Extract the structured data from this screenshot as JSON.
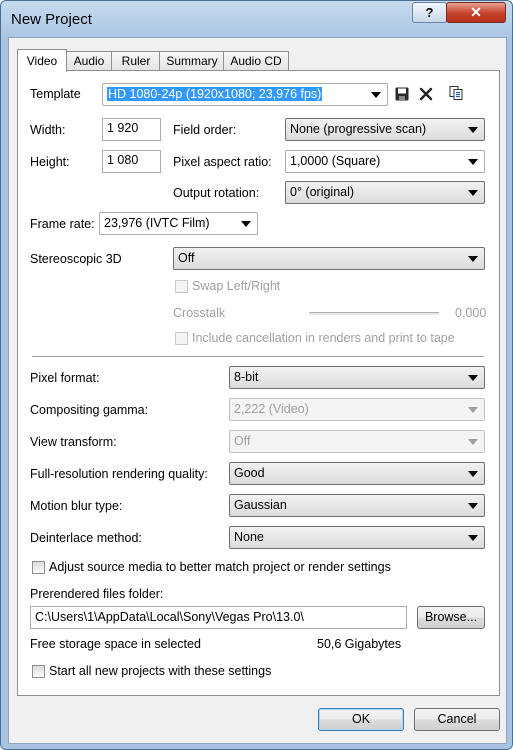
{
  "window": {
    "title": "New Project"
  },
  "titlebar": {
    "help_label": "?",
    "close_label": "✕"
  },
  "tabs": [
    "Video",
    "Audio",
    "Ruler",
    "Summary",
    "Audio CD"
  ],
  "video": {
    "template_label": "Template",
    "template_value": "HD 1080-24p (1920x1080; 23,976 fps)",
    "width_label": "Width:",
    "width_value": "1 920",
    "height_label": "Height:",
    "height_value": "1 080",
    "field_order_label": "Field order:",
    "field_order_value": "None (progressive scan)",
    "pixel_aspect_label": "Pixel aspect ratio:",
    "pixel_aspect_value": "1,0000 (Square)",
    "output_rotation_label": "Output rotation:",
    "output_rotation_value": "0° (original)",
    "frame_rate_label": "Frame rate:",
    "frame_rate_value": "23,976 (IVTC Film)",
    "stereo_label": "Stereoscopic 3D",
    "stereo_value": "Off",
    "swap_label": "Swap Left/Right",
    "crosstalk_label": "Crosstalk",
    "crosstalk_value": "0,000",
    "include_cancel_label": "Include cancellation in renders and print to tape",
    "pixel_format_label": "Pixel format:",
    "pixel_format_value": "8-bit",
    "compositing_gamma_label": "Compositing gamma:",
    "compositing_gamma_value": "2,222 (Video)",
    "view_transform_label": "View transform:",
    "view_transform_value": "Off",
    "render_quality_label": "Full-resolution rendering quality:",
    "render_quality_value": "Good",
    "motion_blur_label": "Motion blur type:",
    "motion_blur_value": "Gaussian",
    "deinterlace_label": "Deinterlace method:",
    "deinterlace_value": "None",
    "adjust_source_label": "Adjust source media to better match project or render settings",
    "prerendered_label": "Prerendered files folder:",
    "prerendered_value": "C:\\Users\\1\\AppData\\Local\\Sony\\Vegas Pro\\13.0\\",
    "browse_label": "Browse...",
    "free_storage_label": "Free storage space in selected",
    "free_storage_value": "50,6 Gigabytes",
    "start_all_label": "Start all new projects with these settings"
  },
  "footer": {
    "ok_label": "OK",
    "cancel_label": "Cancel"
  },
  "icons": [
    "save-icon",
    "delete-icon",
    "copy-template-icon"
  ]
}
